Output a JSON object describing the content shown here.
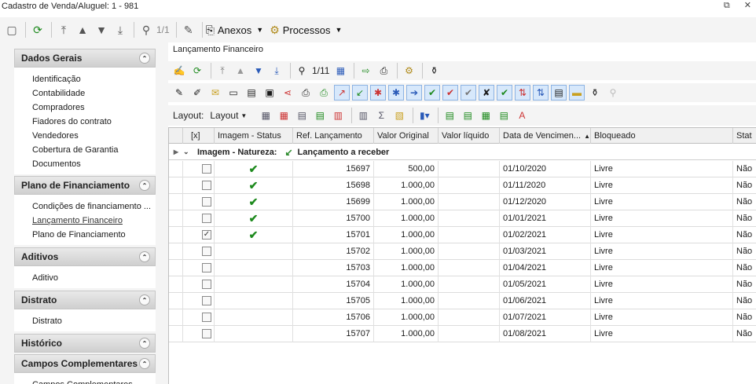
{
  "window": {
    "title": "Cadastro de Venda/Aluguel: 1 - 981",
    "restore_glyph": "⧉",
    "close_glyph": "✕"
  },
  "main_toolbar": {
    "record_counter": "1/1",
    "anexos_label": "Anexos",
    "processos_label": "Processos"
  },
  "nav": {
    "groups": [
      {
        "title": "Dados Gerais",
        "items": [
          "Identificação",
          "Contabilidade",
          "Compradores",
          "Fiadores do contrato",
          "Vendedores",
          "Cobertura de Garantia",
          "Documentos"
        ]
      },
      {
        "title": "Plano de Financiamento",
        "items": [
          "Condições de financiamento ...",
          "Lançamento Financeiro",
          "Plano de Financiamento"
        ]
      },
      {
        "title": "Aditivos",
        "items": [
          "Aditivo"
        ]
      },
      {
        "title": "Distrato",
        "items": [
          "Distrato"
        ]
      },
      {
        "title": "Histórico",
        "items": []
      },
      {
        "title": "Campos Complementares",
        "items": [
          "Campos Complementares"
        ]
      }
    ],
    "active_item": "Lançamento Financeiro"
  },
  "panel": {
    "title": "Lançamento Financeiro",
    "record_counter": "1/11",
    "layout_label": "Layout:",
    "layout_dropdown": "Layout"
  },
  "grid": {
    "columns": [
      "[x]",
      "Imagem - Status",
      "Ref. Lançamento",
      "Valor Original",
      "Valor líquido",
      "Data de Vencimen...",
      "Bloqueado",
      "Stat"
    ],
    "group_label": "Imagem - Natureza:",
    "group_value": "Lançamento a receber",
    "rows": [
      {
        "checked": false,
        "status_ok": true,
        "ref": "15697",
        "valor_original": "500,00",
        "valor_liquido": "",
        "vencimento": "01/10/2020",
        "bloqueado": "Livre",
        "stat": "Não"
      },
      {
        "checked": false,
        "status_ok": true,
        "ref": "15698",
        "valor_original": "1.000,00",
        "valor_liquido": "",
        "vencimento": "01/11/2020",
        "bloqueado": "Livre",
        "stat": "Não"
      },
      {
        "checked": false,
        "status_ok": true,
        "ref": "15699",
        "valor_original": "1.000,00",
        "valor_liquido": "",
        "vencimento": "01/12/2020",
        "bloqueado": "Livre",
        "stat": "Não"
      },
      {
        "checked": false,
        "status_ok": true,
        "ref": "15700",
        "valor_original": "1.000,00",
        "valor_liquido": "",
        "vencimento": "01/01/2021",
        "bloqueado": "Livre",
        "stat": "Não"
      },
      {
        "checked": true,
        "status_ok": true,
        "ref": "15701",
        "valor_original": "1.000,00",
        "valor_liquido": "",
        "vencimento": "01/02/2021",
        "bloqueado": "Livre",
        "stat": "Não"
      },
      {
        "checked": false,
        "status_ok": false,
        "ref": "15702",
        "valor_original": "1.000,00",
        "valor_liquido": "",
        "vencimento": "01/03/2021",
        "bloqueado": "Livre",
        "stat": "Não"
      },
      {
        "checked": false,
        "status_ok": false,
        "ref": "15703",
        "valor_original": "1.000,00",
        "valor_liquido": "",
        "vencimento": "01/04/2021",
        "bloqueado": "Livre",
        "stat": "Não"
      },
      {
        "checked": false,
        "status_ok": false,
        "ref": "15704",
        "valor_original": "1.000,00",
        "valor_liquido": "",
        "vencimento": "01/05/2021",
        "bloqueado": "Livre",
        "stat": "Não"
      },
      {
        "checked": false,
        "status_ok": false,
        "ref": "15705",
        "valor_original": "1.000,00",
        "valor_liquido": "",
        "vencimento": "01/06/2021",
        "bloqueado": "Livre",
        "stat": "Não"
      },
      {
        "checked": false,
        "status_ok": false,
        "ref": "15706",
        "valor_original": "1.000,00",
        "valor_liquido": "",
        "vencimento": "01/07/2021",
        "bloqueado": "Livre",
        "stat": "Não"
      },
      {
        "checked": false,
        "status_ok": false,
        "ref": "15707",
        "valor_original": "1.000,00",
        "valor_liquido": "",
        "vencimento": "01/08/2021",
        "bloqueado": "Livre",
        "stat": "Não"
      }
    ]
  },
  "icons": {
    "main_toolbar": [
      "new-document-icon",
      "refresh-icon",
      "first-record-icon",
      "previous-record-icon",
      "next-record-icon",
      "last-record-icon",
      "binoculars-icon",
      "edit-pen-icon",
      "paperclip-icon",
      "gears-icon"
    ],
    "toolbar2": [
      "edit-icon",
      "refresh-icon",
      "first-icon",
      "previous-icon",
      "next-icon",
      "last-icon",
      "find-icon",
      "calendar-icon",
      "export-icon",
      "print-icon",
      "process-icon",
      "filter-icon"
    ],
    "toolbar3": [
      "pencil-icon",
      "pencil-alt-icon",
      "envelope-icon",
      "card-icon",
      "stamp-icon",
      "register-icon",
      "share-icon",
      "printer-icon",
      "printer-green-icon",
      "arrow-up-red-icon",
      "arrow-down-green-icon",
      "asterisk-red-icon",
      "asterisk-blue-icon",
      "arrow-right-blue-icon",
      "check-green-icon",
      "check-red-icon",
      "check-gray-icon",
      "x-icon",
      "check-money-icon",
      "sort-icon",
      "sort-alt-icon",
      "note-icon",
      "highlight-icon",
      "filter-alt-icon",
      "search-disabled-icon"
    ],
    "toolbar4": [
      "grid-icon",
      "grid-delete-icon",
      "grid-list-icon",
      "grid-down-icon",
      "grid-export-icon",
      "columns-icon",
      "sum-icon",
      "picture-icon",
      "chart-icon",
      "green-grid-icon",
      "green-grid-2-icon",
      "green-grid-3-icon",
      "green-grid-4-icon",
      "text-icon"
    ]
  },
  "colors": {
    "accent_green": "#1e8a1e",
    "header_gray": "#d4d4d4",
    "highlight_blue": "#d7e8fb"
  }
}
